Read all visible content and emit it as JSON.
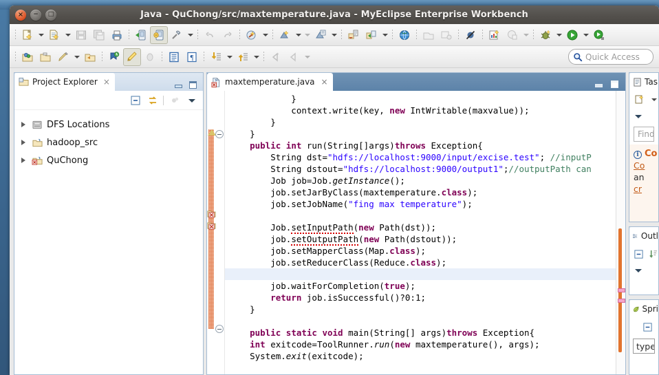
{
  "window": {
    "title": "Java - QuChong/src/maxtemperature.java - MyEclipse Enterprise Workbench",
    "close_glyph": "×",
    "minimize_glyph": "−",
    "maximize_glyph": "□"
  },
  "quick_access": {
    "placeholder": "Quick Access",
    "icon": "search-icon"
  },
  "toolbar_main": {
    "items": [
      {
        "name": "new-wizard",
        "icon": "new-file-icon",
        "dropdown": true,
        "enabled": true
      },
      {
        "name": "new-from-template",
        "icon": "new-template-icon",
        "dropdown": true,
        "enabled": true
      },
      {
        "name": "save",
        "icon": "save-icon",
        "dropdown": false,
        "enabled": false
      },
      {
        "name": "save-all",
        "icon": "save-all-icon",
        "dropdown": false,
        "enabled": false
      },
      {
        "name": "print",
        "icon": "print-icon",
        "dropdown": false,
        "enabled": true
      },
      {
        "name": "run-server",
        "icon": "deploy-icon",
        "dropdown": false,
        "enabled": true
      },
      {
        "name": "myeclipse-deploy",
        "icon": "myeclipse-deploy-icon",
        "dropdown": false,
        "enabled": true,
        "pressed": true
      },
      {
        "name": "build-project",
        "icon": "hammer-icon",
        "dropdown": true,
        "enabled": true
      },
      {
        "name": "undo",
        "icon": "undo-icon",
        "dropdown": false,
        "enabled": false
      },
      {
        "name": "redo",
        "icon": "redo-icon",
        "dropdown": false,
        "enabled": false
      },
      {
        "name": "new-java-package",
        "icon": "package-new-icon",
        "dropdown": true,
        "enabled": true
      },
      {
        "name": "new-java-class",
        "icon": "class-new-icon",
        "dropdown": true,
        "enabled": true
      },
      {
        "name": "new-java-interface",
        "icon": "interface-new-icon",
        "dropdown": true,
        "enabled": true
      },
      {
        "name": "export-wizard",
        "icon": "export-icon",
        "dropdown": false,
        "enabled": true
      },
      {
        "name": "import-wizard",
        "icon": "import-icon",
        "dropdown": true,
        "enabled": true
      },
      {
        "name": "open-browser",
        "icon": "globe-icon",
        "dropdown": false,
        "enabled": true
      },
      {
        "name": "open-type",
        "icon": "open-type-icon",
        "dropdown": false,
        "enabled": false
      },
      {
        "name": "search",
        "icon": "search-all-icon",
        "dropdown": false,
        "enabled": false
      },
      {
        "name": "skip-breakpoints",
        "icon": "skip-breakpoints-icon",
        "dropdown": false,
        "enabled": true
      },
      {
        "name": "new-report",
        "icon": "report-new-icon",
        "dropdown": false,
        "enabled": true
      },
      {
        "name": "profile",
        "icon": "profile-icon",
        "dropdown": true,
        "enabled": false
      },
      {
        "name": "debug",
        "icon": "debug-bug-icon",
        "dropdown": true,
        "enabled": true
      },
      {
        "name": "run",
        "icon": "run-green-play-icon",
        "dropdown": true,
        "enabled": true
      },
      {
        "name": "run-history",
        "icon": "run-history-icon",
        "dropdown": false,
        "enabled": true
      }
    ]
  },
  "toolbar_secondary": {
    "items": [
      {
        "name": "open-perspective",
        "icon": "open-perspective-icon",
        "dropdown": false,
        "enabled": true
      },
      {
        "name": "open-resource",
        "icon": "folder-open-icon",
        "dropdown": false,
        "enabled": true
      },
      {
        "name": "new-editor",
        "icon": "pen-icon",
        "dropdown": true,
        "enabled": true
      },
      {
        "name": "open-folder",
        "icon": "folder-arrow-icon",
        "dropdown": false,
        "enabled": true
      },
      {
        "name": "toggle-mark-occurrences",
        "icon": "mark-occurrences-icon",
        "dropdown": false,
        "enabled": true
      },
      {
        "name": "toggle-highlight",
        "icon": "highlight-pencil-icon",
        "dropdown": false,
        "enabled": true,
        "pressed": true
      },
      {
        "name": "toggle-ant",
        "icon": "ant-icon",
        "dropdown": false,
        "enabled": false
      },
      {
        "name": "show-whitespace",
        "icon": "block-selection-icon",
        "dropdown": false,
        "enabled": true
      },
      {
        "name": "show-pilcrow",
        "icon": "pilcrow-icon",
        "dropdown": false,
        "enabled": true
      },
      {
        "name": "next-annotation",
        "icon": "next-annotation-icon",
        "dropdown": true,
        "enabled": true
      },
      {
        "name": "previous-annotation",
        "icon": "prev-annotation-icon",
        "dropdown": true,
        "enabled": true
      },
      {
        "name": "back",
        "icon": "back-arrow-icon",
        "dropdown": false,
        "enabled": false
      },
      {
        "name": "forward",
        "icon": "forward-arrow-icon",
        "dropdown": true,
        "enabled": false
      }
    ]
  },
  "project_explorer": {
    "tab_label": "Project Explorer",
    "tab_icon": "project-explorer-icon",
    "close_glyph": "×",
    "toolbar": [
      {
        "name": "collapse-all",
        "icon": "collapse-all-icon"
      },
      {
        "name": "link-with-editor",
        "icon": "link-editor-icon"
      },
      {
        "name": "focus-on-active-task",
        "icon": "focus-task-icon"
      },
      {
        "name": "view-menu",
        "icon": "view-menu-icon"
      }
    ],
    "tree": [
      {
        "label": "DFS Locations",
        "icon": "dfs-locations-icon",
        "expanded": false
      },
      {
        "label": "hadoop_src",
        "icon": "java-project-icon",
        "expanded": false
      },
      {
        "label": "QuChong",
        "icon": "java-project-error-icon",
        "expanded": false
      }
    ]
  },
  "editor": {
    "tab_label": "maxtemperature.java",
    "tab_icon": "java-file-error-icon",
    "close_glyph": "×",
    "minimize_label": "Minimize",
    "maximize_label": "Maximize",
    "code_lines": [
      {
        "indent": 0,
        "html": "            }"
      },
      {
        "indent": 0,
        "html": "            context.write(key, <span class=\"kw\">new</span> IntWritable(maxvalue));"
      },
      {
        "indent": 0,
        "html": "        }"
      },
      {
        "indent": 0,
        "html": "    }"
      },
      {
        "indent": 0,
        "html": "    <span class=\"kw\">public int</span> run(String[]args)<span class=\"kw\">throws</span> Exception{",
        "fold": true
      },
      {
        "indent": 0,
        "html": "        String dst=<span class=\"str\">\"hdfs://localhost:9000/input/excise.test\"</span>; <span class=\"cmt\">//inputP</span>"
      },
      {
        "indent": 0,
        "html": "        String dstout=<span class=\"str\">\"hdfs://localhost:9000/output1\"</span>;<span class=\"cmt\">//outputPath can</span>"
      },
      {
        "indent": 0,
        "html": "        Job job=Job.<span class=\"itl\">getInstance</span>();"
      },
      {
        "indent": 0,
        "html": "        job.setJarByClass(maxtemperature.<span class=\"kw\">class</span>);"
      },
      {
        "indent": 0,
        "html": "        job.setJobName(<span class=\"str\">\"fing max temperature\"</span>);"
      },
      {
        "indent": 0,
        "html": ""
      },
      {
        "indent": 0,
        "html": "        Job.<span class=\"err-under\">setInputPath</span>(<span class=\"kw\">new</span> Path(dst));"
      },
      {
        "indent": 0,
        "html": "        job.<span class=\"err-under\">setOutputPath</span>(<span class=\"kw\">new</span> Path(dstout));"
      },
      {
        "indent": 0,
        "html": "        job.setMapperClass(Map.<span class=\"kw\">class</span>);"
      },
      {
        "indent": 0,
        "html": "        job.setReducerClass(Reduce.<span class=\"kw\">class</span>);"
      },
      {
        "indent": 0,
        "html": "",
        "highlight": true
      },
      {
        "indent": 0,
        "html": "        job.waitForCompletion(<span class=\"kw\">true</span>);"
      },
      {
        "indent": 0,
        "html": "        <span class=\"kw\">return</span> job.isSuccessful()?0:1;"
      },
      {
        "indent": 0,
        "html": "    }"
      },
      {
        "indent": 0,
        "html": ""
      },
      {
        "indent": 0,
        "html": "    <span class=\"kw\">public static void</span> main(String[] args)<span class=\"kw\">throws</span> Exception{",
        "fold": true
      },
      {
        "indent": 0,
        "html": "    <span class=\"kw\">int</span> exitcode=ToolRunner.<span class=\"itl\">run</span>(<span class=\"kw\">new</span> maxtemperature(), args);"
      },
      {
        "indent": 0,
        "html": "    System.<span class=\"itl\">exit</span>(exitcode);"
      }
    ]
  },
  "tasks_view": {
    "tab_label": "Tas",
    "tab_icon": "tasks-icon",
    "toolbar": [
      {
        "name": "new-task",
        "icon": "new-task-icon",
        "dropdown": true
      },
      {
        "name": "view-menu",
        "icon": "view-menu-icon"
      }
    ],
    "find_placeholder": "Find",
    "notice": {
      "icon": "info-icon",
      "title": "Co",
      "link1": "Co",
      "line2": "an",
      "link2": "cr"
    }
  },
  "outline_view": {
    "tab_label": "Outl",
    "tab_icon": "outline-icon",
    "toolbar": [
      {
        "name": "collapse-all",
        "icon": "collapse-all-icon"
      },
      {
        "name": "sort",
        "icon": "sort-icon"
      },
      {
        "name": "view-menu",
        "icon": "view-menu-icon"
      }
    ]
  },
  "spring_view": {
    "tab_label": "Spri",
    "tab_icon": "spring-leaf-icon",
    "toolbar": [
      {
        "name": "collapse-all",
        "icon": "collapse-all-icon"
      }
    ],
    "filter_text": "type f"
  },
  "colors": {
    "titlebar": "#56534f",
    "accent_orange": "#e2742f",
    "keyword": "#7f0055",
    "string": "#2a00ff",
    "comment": "#3f7f5f",
    "error_red": "#d40000",
    "view_border": "#a5bcd4"
  }
}
